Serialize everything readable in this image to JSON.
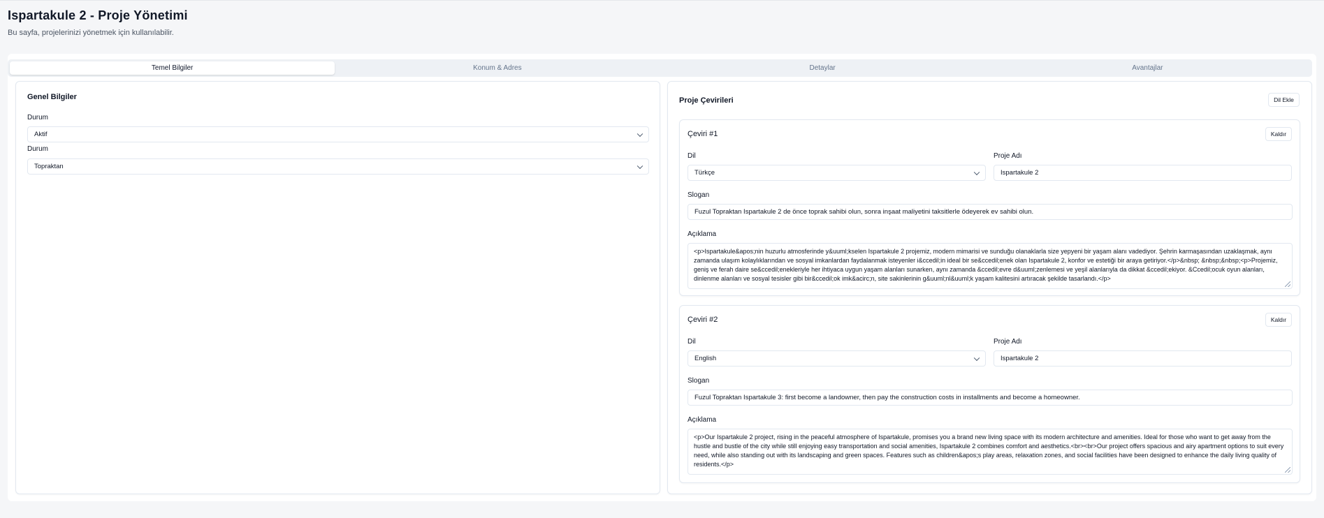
{
  "header": {
    "title": "Ispartakule 2 - Proje Yönetimi",
    "subtitle": "Bu sayfa, projelerinizi yönetmek için kullanılabilir."
  },
  "tabs": [
    {
      "label": "Temel Bilgiler",
      "active": true
    },
    {
      "label": "Konum & Adres",
      "active": false
    },
    {
      "label": "Detaylar",
      "active": false
    },
    {
      "label": "Avantajlar",
      "active": false
    }
  ],
  "general": {
    "title": "Genel Bilgiler",
    "status_label": "Durum",
    "status_value": "Aktif",
    "type_label": "Durum",
    "type_value": "Topraktan"
  },
  "translations": {
    "title": "Proje Çevirileri",
    "add_language_label": "Dil Ekle",
    "items": [
      {
        "title": "Çeviri #1",
        "remove_label": "Kaldır",
        "language_label": "Dil",
        "language_value": "Türkçe",
        "name_label": "Proje Adı",
        "name_value": "Ispartakule 2",
        "slogan_label": "Slogan",
        "slogan_value": "Fuzul Topraktan Ispartakule 2 de önce toprak sahibi olun, sonra inşaat maliyetini taksitlerle ödeyerek ev sahibi olun.",
        "description_label": "Açıklama",
        "description_value": "<p>Ispartakule&apos;nin huzurlu atmosferinde y&uuml;kselen Ispartakule 2 projemiz, modern mimarisi ve sunduğu olanaklarla size yepyeni bir yaşam alanı vadediyor. Şehrin karmaşasından uzaklaşmak, aynı zamanda ulaşım kolaylıklarından ve sosyal imkanlardan faydalanmak isteyenler i&ccedil;in ideal bir se&ccedil;enek olan Ispartakule 2, konfor ve estetiği bir araya getiriyor.</p>&nbsp; &nbsp;&nbsp;<p>Projemiz, geniş ve ferah daire se&ccedil;enekleriyle her ihtiyaca uygun yaşam alanları sunarken, aynı zamanda &ccedil;evre d&uuml;zenlemesi ve yeşil alanlarıyla da dikkat &ccedil;ekiyor. &Ccedil;ocuk oyun alanları, dinlenme alanları ve sosyal tesisler gibi bir&ccedil;ok imk&acirc;n, site sakinlerinin g&uuml;nl&uuml;k yaşam kalitesini artıracak şekilde tasarlandı.</p>"
      },
      {
        "title": "Çeviri #2",
        "remove_label": "Kaldır",
        "language_label": "Dil",
        "language_value": "English",
        "name_label": "Proje Adı",
        "name_value": "Ispartakule 2",
        "slogan_label": "Slogan",
        "slogan_value": "Fuzul Topraktan Ispartakule 3: first become a landowner, then pay the construction costs in installments and become a homeowner.",
        "description_label": "Açıklama",
        "description_value": "<p>Our Ispartakule 2 project, rising in the peaceful atmosphere of Ispartakule, promises you a brand new living space with its modern architecture and amenities. Ideal for those who want to get away from the hustle and bustle of the city while still enjoying easy transportation and social amenities, Ispartakule 2 combines comfort and aesthetics.<br><br>Our project offers spacious and airy apartment options to suit every need, while also standing out with its landscaping and green spaces. Features such as children&apos;s play areas, relaxation zones, and social facilities have been designed to enhance the daily living quality of residents.</p>"
      }
    ]
  }
}
